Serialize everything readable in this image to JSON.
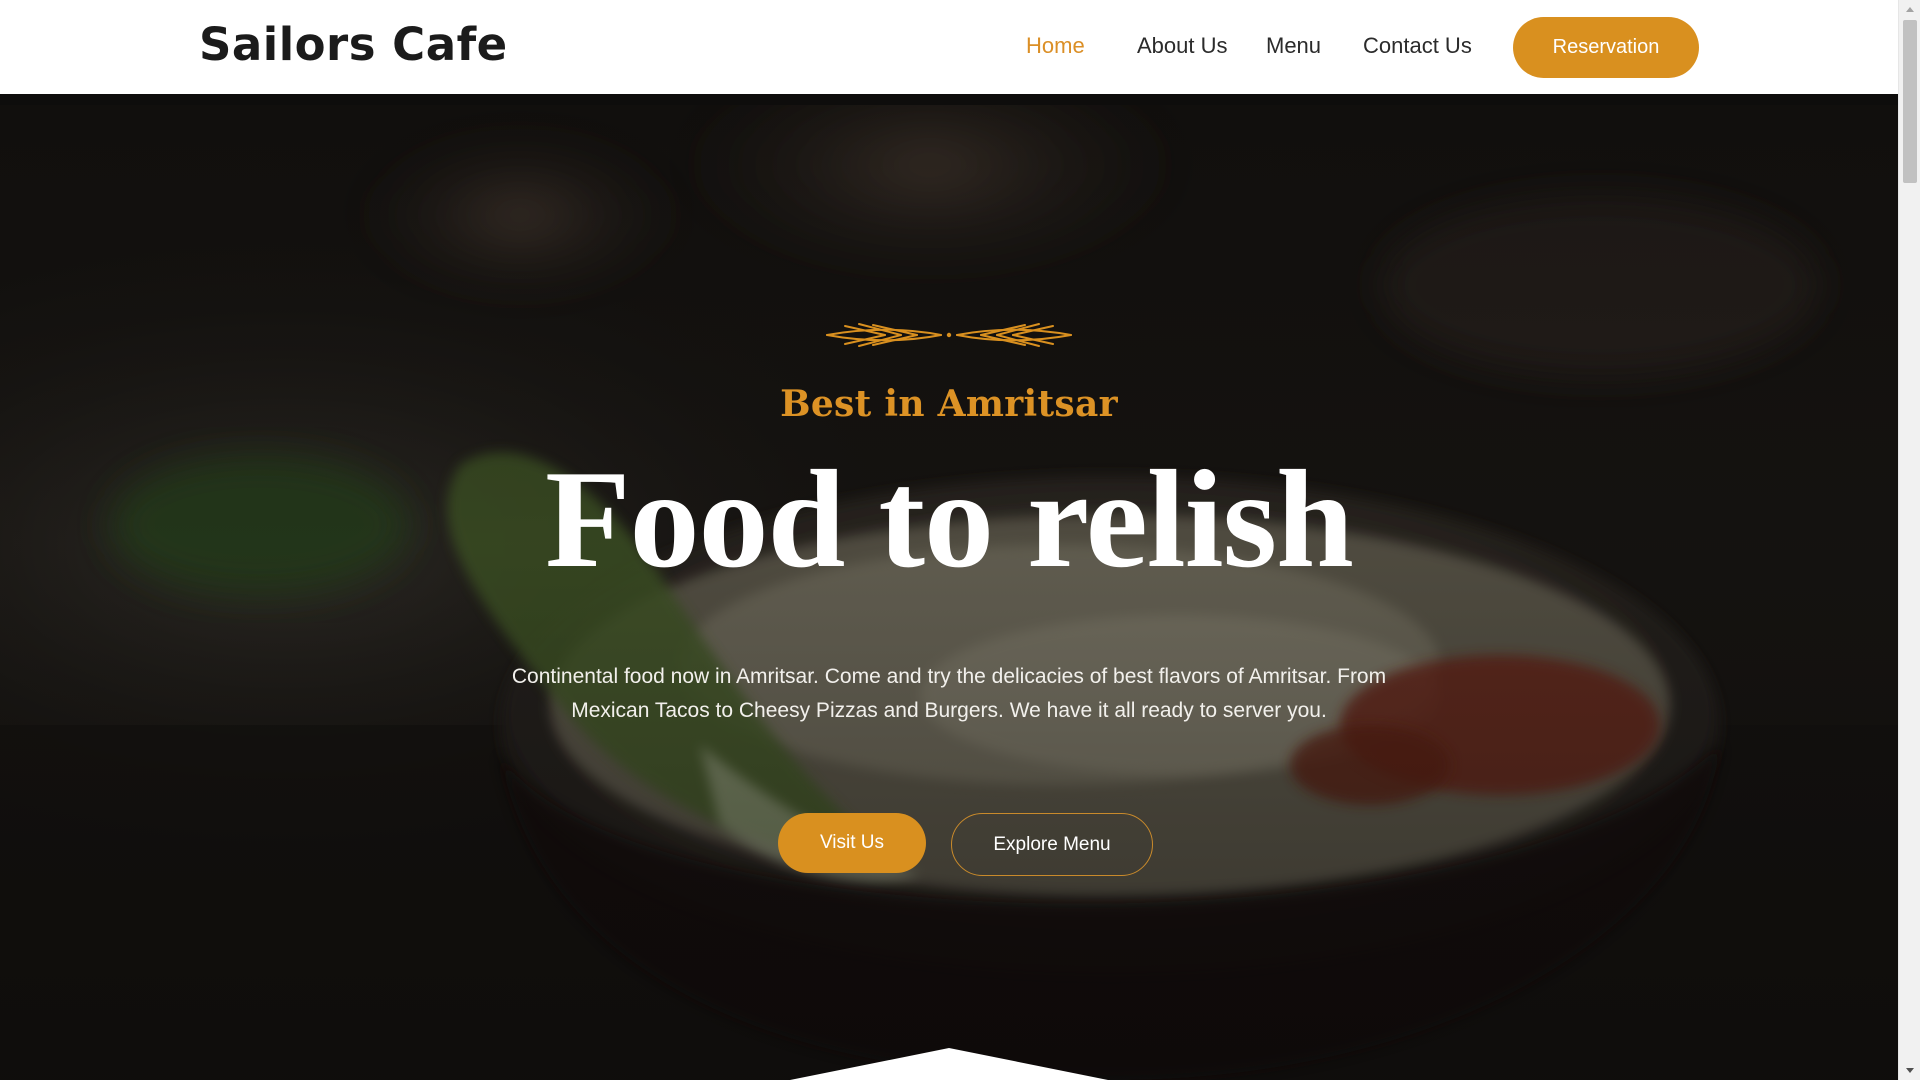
{
  "header": {
    "brand": "Sailors Cafe",
    "nav": [
      {
        "label": "Home",
        "active": true
      },
      {
        "label": "About Us",
        "active": false
      },
      {
        "label": "Menu",
        "active": false
      },
      {
        "label": "Contact Us",
        "active": false
      }
    ],
    "reservation_label": "Reservation"
  },
  "hero": {
    "tagline": "Best in Amritsar",
    "headline": "Food to relish",
    "description": "Continental food now in Amritsar. Come and try the delicacies of best flavors of Amritsar. From Mexican Tacos to Cheesy Pizzas and Burgers. We have it all ready to server you.",
    "primary_button": "Visit Us",
    "secondary_button": "Explore Menu",
    "background": "blurred-bowl-of-noodle-soup-photo",
    "ornament_icon": "wheat-flourish-icon"
  },
  "colors": {
    "accent": "#d9901f",
    "heading": "#1b1b1b",
    "nav_text": "#2b2b2b",
    "hero_text": "#ffffff"
  }
}
